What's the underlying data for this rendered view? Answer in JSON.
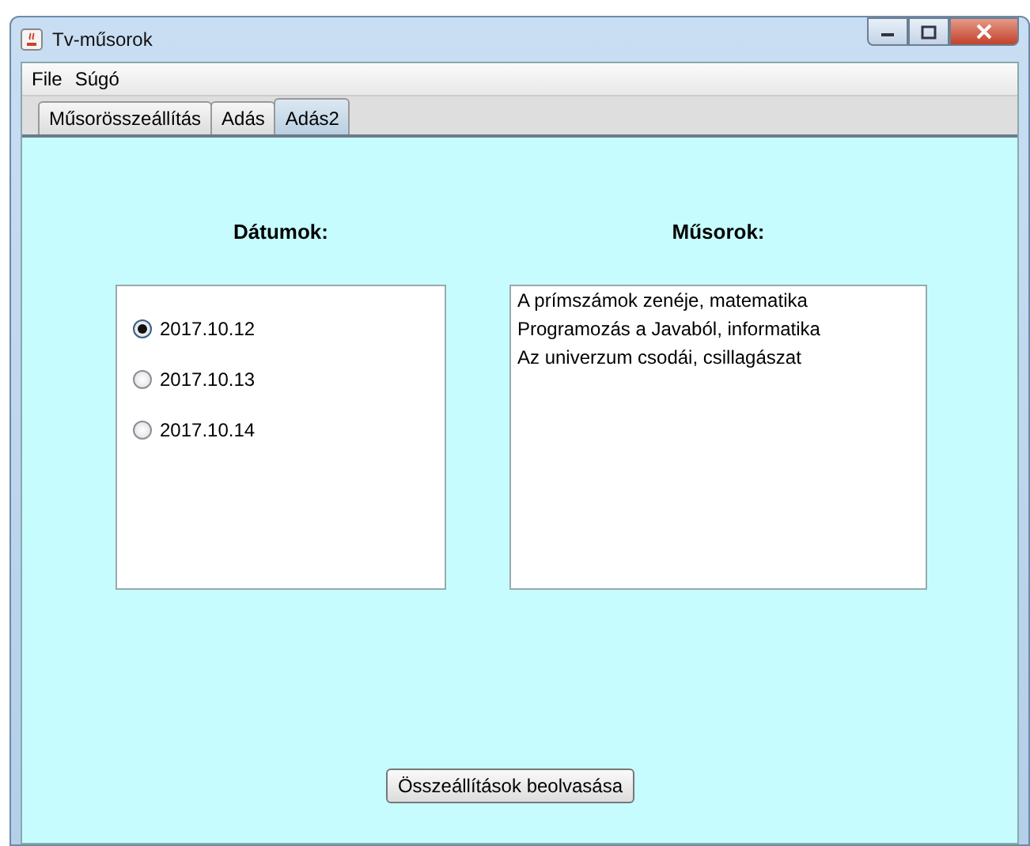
{
  "window": {
    "title": "Tv-műsorok"
  },
  "menu": [
    "File",
    "Súgó"
  ],
  "tabs": [
    {
      "label": "Műsorösszeállítás",
      "selected": false
    },
    {
      "label": "Adás",
      "selected": false
    },
    {
      "label": "Adás2",
      "selected": true
    }
  ],
  "dates": {
    "heading": "Dátumok:",
    "options": [
      {
        "label": "2017.10.12",
        "selected": true
      },
      {
        "label": "2017.10.13",
        "selected": false
      },
      {
        "label": "2017.10.14",
        "selected": false
      }
    ]
  },
  "shows": {
    "heading": "Műsorok:",
    "items": [
      "A prímszámok zenéje, matematika",
      "Programozás a Javaból, informatika",
      "Az univerzum csodái, csillagászat"
    ]
  },
  "button": "Összeállítások beolvasása"
}
